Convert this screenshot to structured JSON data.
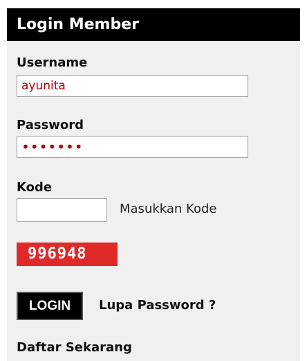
{
  "panel": {
    "title": "Login Member"
  },
  "form": {
    "username_label": "Username",
    "username_value": "ayunita",
    "password_label": "Password",
    "password_value": "•••••••",
    "kode_label": "Kode",
    "kode_value": "",
    "kode_hint": "Masukkan Kode",
    "captcha_text": "996948"
  },
  "actions": {
    "login_label": "LOGIN",
    "forgot_label": "Lupa Password ?",
    "register_label": "Daftar Sekarang"
  }
}
